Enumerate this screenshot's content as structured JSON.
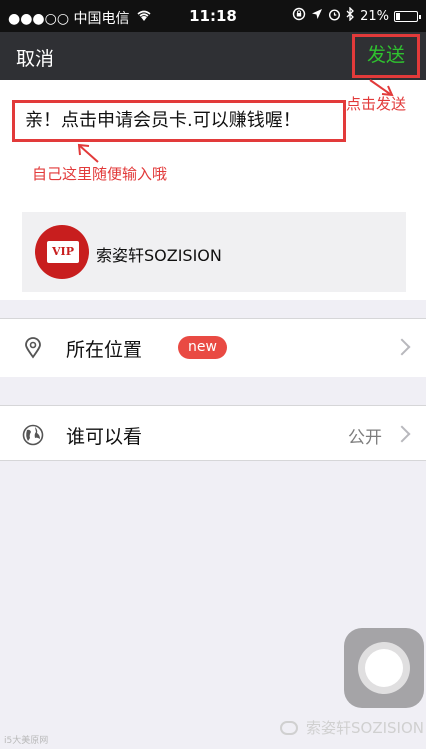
{
  "status_bar": {
    "carrier": "●●●○○ 中国电信",
    "time": "11:18",
    "battery_text": "21%",
    "battery_level": 0.21
  },
  "nav": {
    "cancel_label": "取消",
    "send_label": "发送"
  },
  "annotations": {
    "send_hint": "点击发送",
    "input_hint": "自己这里随便输入哦"
  },
  "compose": {
    "message_text": "亲！点击申请会员卡.可以赚钱喔！"
  },
  "share_card": {
    "logo_text": "VIP",
    "title": "索姿轩SOZISION"
  },
  "rows": {
    "location_label": "所在位置",
    "location_badge": "new",
    "visibility_label": "谁可以看",
    "visibility_value": "公开"
  },
  "watermark": {
    "left_text": "i5大美原网",
    "right_text": "索姿轩SOZISION"
  },
  "colors": {
    "accent_send": "#2fc12f",
    "annotation_red": "#e23a3a",
    "badge_red": "#e94a43",
    "nav_background": "#2f3034"
  }
}
